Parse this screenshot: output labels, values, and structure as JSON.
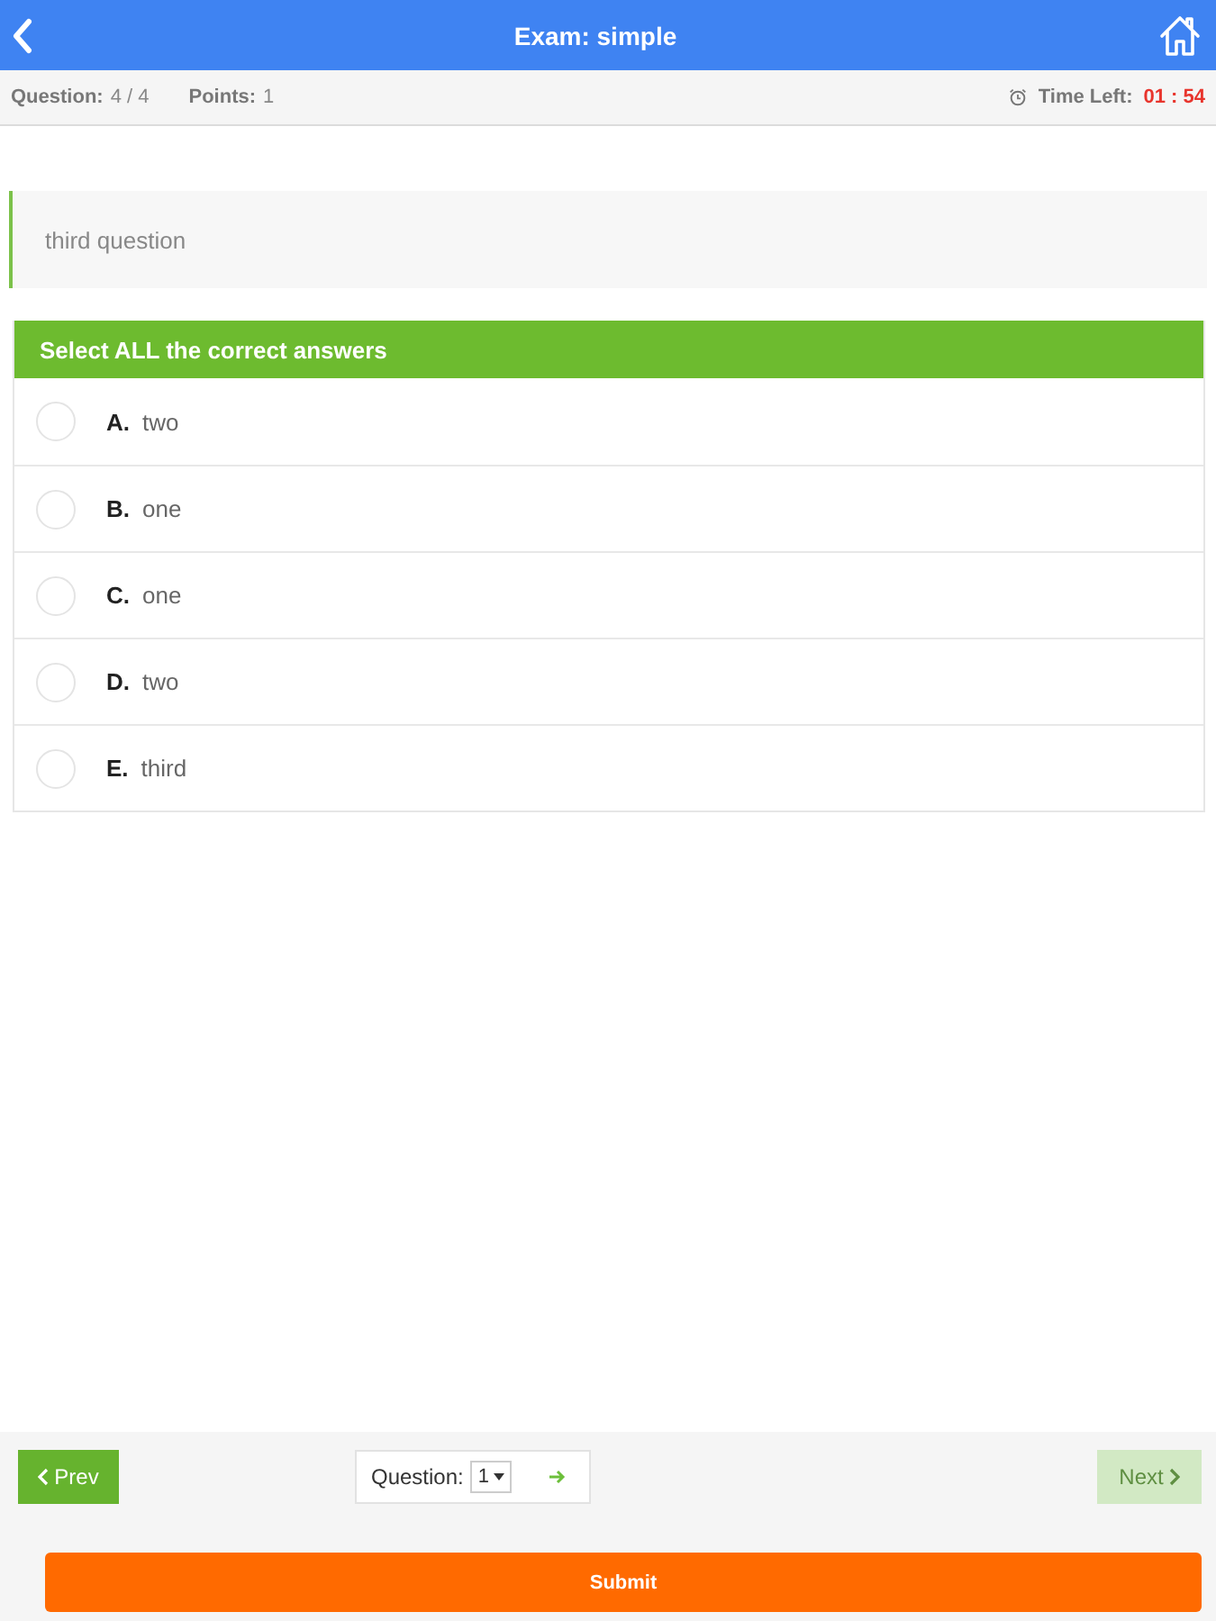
{
  "header": {
    "title": "Exam: simple"
  },
  "info_bar": {
    "question_label": "Question:",
    "question_value": "4 / 4",
    "points_label": "Points:",
    "points_value": "1",
    "time_label": "Time Left:",
    "time_value": "01 : 54"
  },
  "question": {
    "text": "third question"
  },
  "answers": {
    "instruction": "Select ALL the correct answers",
    "options": [
      {
        "letter": "A.",
        "text": "two",
        "checked": false
      },
      {
        "letter": "B.",
        "text": "one",
        "checked": false
      },
      {
        "letter": "C.",
        "text": "one",
        "checked": false
      },
      {
        "letter": "D.",
        "text": "two",
        "checked": false
      },
      {
        "letter": "E.",
        "text": "third",
        "checked": false
      }
    ]
  },
  "footer": {
    "prev": {
      "label": "Prev",
      "disabled": false
    },
    "jump": {
      "label": "Question:",
      "value": "1"
    },
    "next": {
      "label": "Next",
      "disabled": true
    },
    "submit": "Submit"
  }
}
